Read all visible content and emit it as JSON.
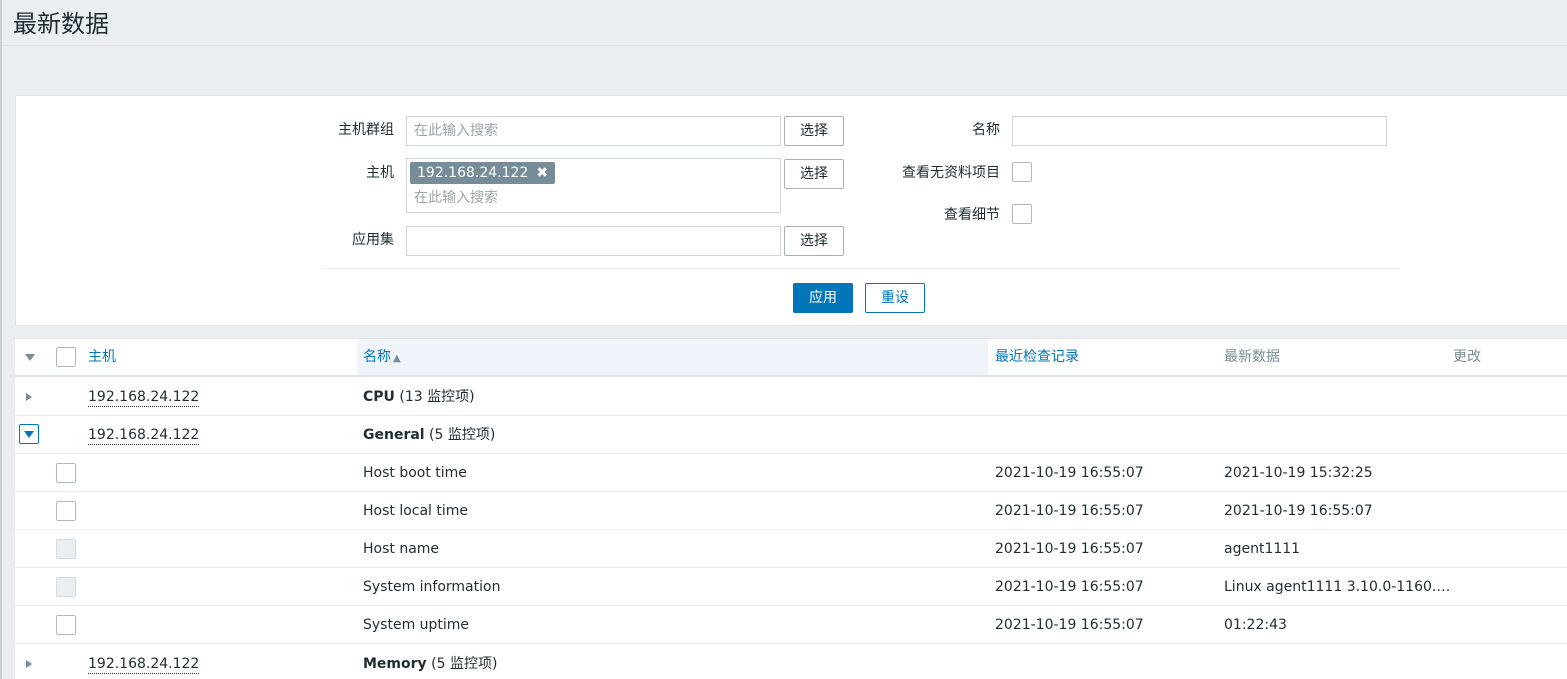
{
  "page": {
    "title": "最新数据"
  },
  "filter": {
    "host_group_label": "主机群组",
    "host_group_placeholder": "在此输入搜索",
    "host_label": "主机",
    "host_chip": "192.168.24.122",
    "host_placeholder": "在此输入搜索",
    "application_label": "应用集",
    "select_label": "选择",
    "name_label": "名称",
    "name_value": "",
    "show_without_data_label": "查看无资料项目",
    "show_details_label": "查看细节",
    "apply_label": "应用",
    "reset_label": "重设"
  },
  "table": {
    "headers": {
      "host": "主机",
      "name": "名称",
      "last_check": "最近检查记录",
      "last_value": "最新数据",
      "change": "更改"
    },
    "groups": [
      {
        "host": "192.168.24.122",
        "app": "CPU",
        "count": " (13 监控项)",
        "expanded": false
      },
      {
        "host": "192.168.24.122",
        "app": "General",
        "count": " (5 监控项)",
        "expanded": true
      },
      {
        "host": "192.168.24.122",
        "app": "Memory",
        "count": " (5 监控项)",
        "expanded": false
      }
    ],
    "items": [
      {
        "name": "Host boot time",
        "last_check": "2021-10-19 16:55:07",
        "last_value": "2021-10-19 15:32:25",
        "checkbox_enabled": true
      },
      {
        "name": "Host local time",
        "last_check": "2021-10-19 16:55:07",
        "last_value": "2021-10-19 16:55:07",
        "checkbox_enabled": true
      },
      {
        "name": "Host name",
        "last_check": "2021-10-19 16:55:07",
        "last_value": "agent1111",
        "checkbox_enabled": false
      },
      {
        "name": "System information",
        "last_check": "2021-10-19 16:55:07",
        "last_value": "Linux agent1111 3.10.0-1160.…",
        "checkbox_enabled": false
      },
      {
        "name": "System uptime",
        "last_check": "2021-10-19 16:55:07",
        "last_value": "01:22:43",
        "checkbox_enabled": true
      }
    ]
  },
  "colors": {
    "accent": "#0275b8",
    "chip": "#768d99",
    "page_bg": "#ebeef0"
  }
}
